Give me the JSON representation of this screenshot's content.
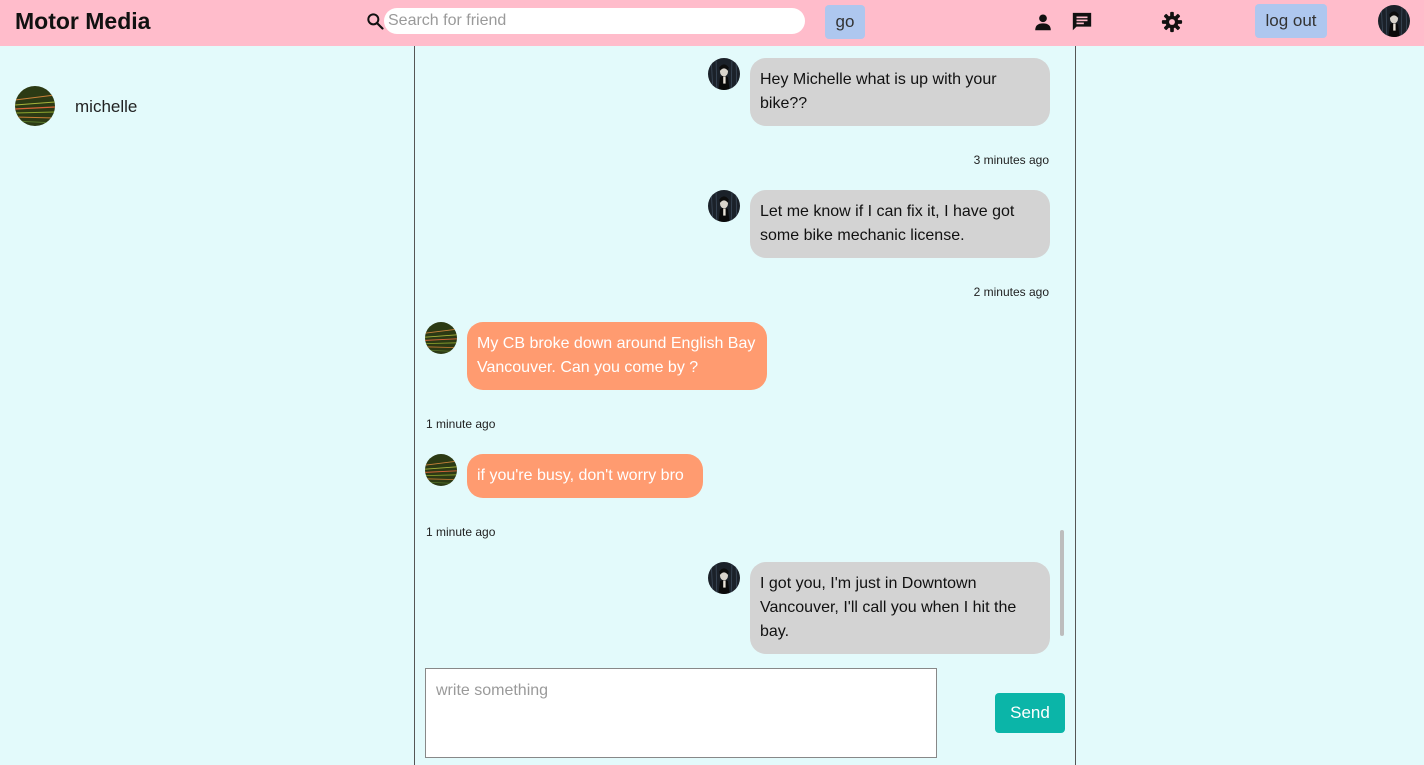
{
  "header": {
    "brand": "Motor Media",
    "search_placeholder": "Search for friend",
    "go_label": "go",
    "logout_label": "log out",
    "icons": [
      "search-icon",
      "profile-icon",
      "messages-icon",
      "settings-icon"
    ]
  },
  "sidebar": {
    "friends": [
      {
        "name": "michelle"
      }
    ]
  },
  "chat": {
    "messages": [
      {
        "from": "me",
        "text": "Hey Michelle what is up with your bike??",
        "time": "3 minutes ago"
      },
      {
        "from": "me",
        "text": "Let me know if I can fix it, I have got some bike mechanic license.",
        "time": "2 minutes ago"
      },
      {
        "from": "michelle",
        "text": "My CB broke down around English Bay Vancouver. Can you come by ?",
        "time": "1 minute ago"
      },
      {
        "from": "michelle",
        "text": "if you're busy, don't worry bro",
        "time": "1 minute ago"
      },
      {
        "from": "me",
        "text": "I got you, I'm just in Downtown Vancouver, I'll call you when I hit the bay.",
        "time": ""
      }
    ],
    "compose_placeholder": "write something",
    "send_label": "Send"
  },
  "colors": {
    "header_bg": "#ffbccb",
    "page_bg": "#e3fafb",
    "my_bubble": "#d3d3d3",
    "their_bubble": "#ff9b70",
    "send_button": "#0bb5a8",
    "header_button": "#aec7ef"
  }
}
